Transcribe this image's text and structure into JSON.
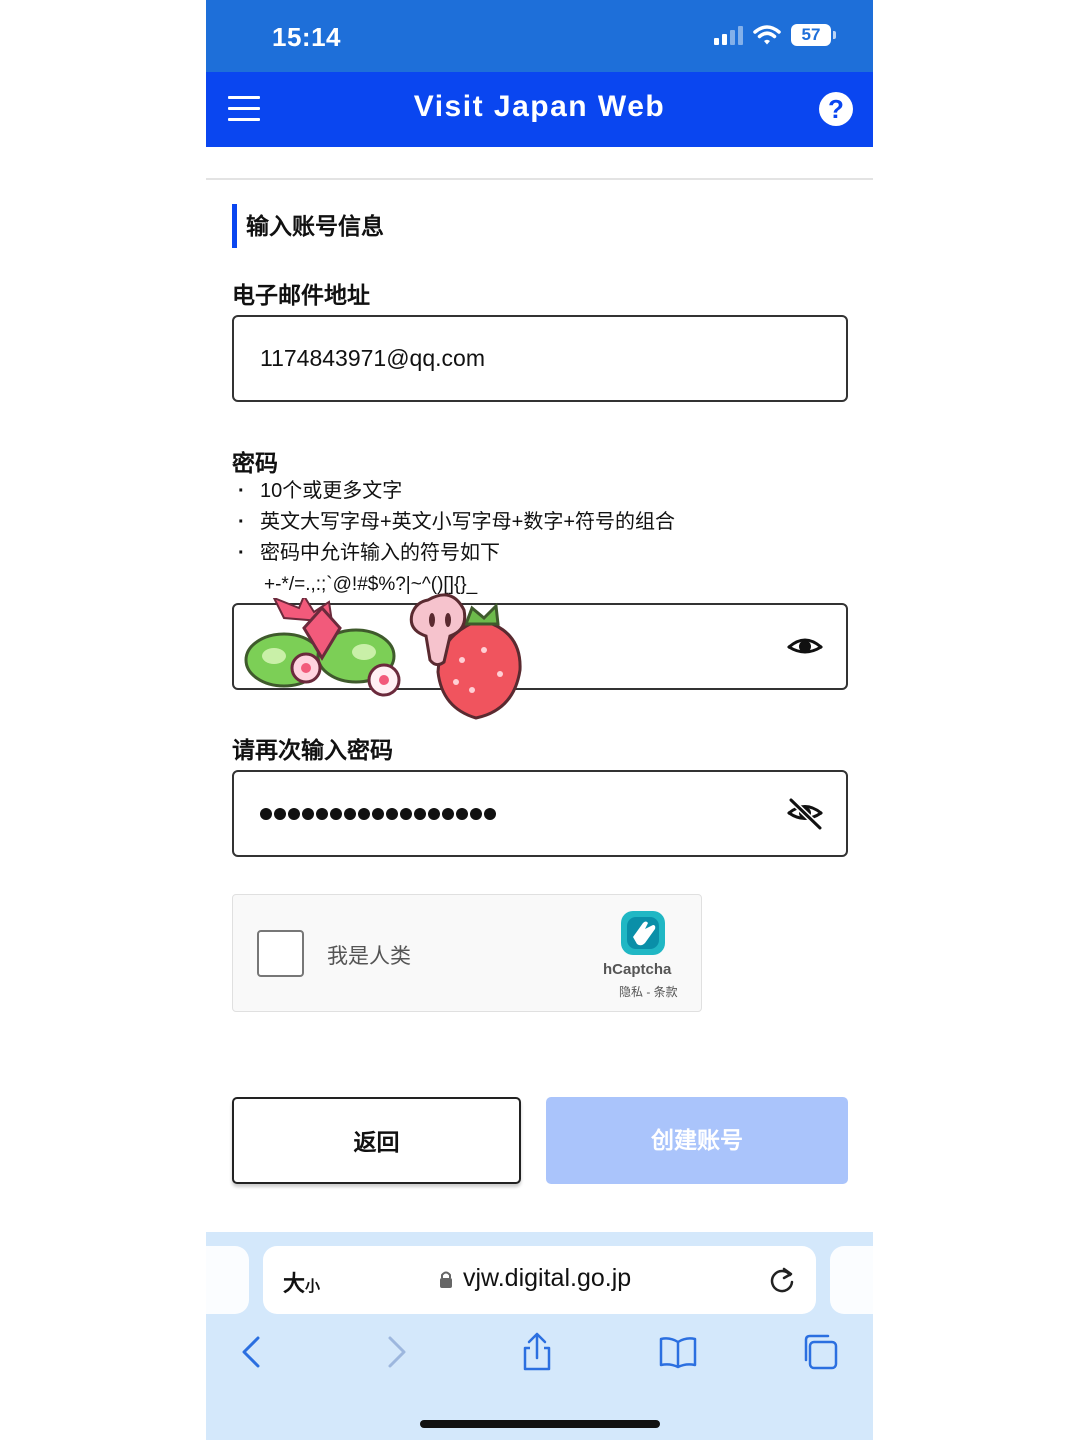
{
  "status_bar": {
    "time": "15:14",
    "battery": "57",
    "icons": [
      "signal-icon",
      "wifi-icon",
      "battery-icon"
    ]
  },
  "header": {
    "title": "Visit Japan Web",
    "menu_icon": "menu-icon",
    "help_icon": "help-icon",
    "help_glyph": "?"
  },
  "form": {
    "section_title": "输入账号信息",
    "email": {
      "label": "电子邮件地址",
      "value": "1174843971@qq.com"
    },
    "password": {
      "label": "密码",
      "hints": [
        "10个或更多文字",
        "英文大写字母+英文小写字母+数字+符号的组合",
        "密码中允许输入的符号如下"
      ],
      "symbols": "+-*/=.,:;`@!#$%?|~^()[]{}_",
      "visibility_icon": "eye-icon"
    },
    "confirm": {
      "label": "请再次输入密码",
      "visibility_icon": "eye-off-icon"
    }
  },
  "captcha": {
    "label": "我是人类",
    "brand": "hCaptcha",
    "links": "隐私 - 条款"
  },
  "buttons": {
    "back": "返回",
    "create": "创建账号"
  },
  "browser": {
    "text_size": "大",
    "text_size_small": "小",
    "url": "vjw.digital.go.jp",
    "toolbar": [
      "back-icon",
      "forward-icon",
      "share-icon",
      "bookmarks-icon",
      "tabs-icon"
    ]
  },
  "colors": {
    "status_bar": "#1e6fd9",
    "header": "#0a46f0",
    "create_button": "#aac4fb",
    "browser_bg": "#d4e8fb"
  }
}
